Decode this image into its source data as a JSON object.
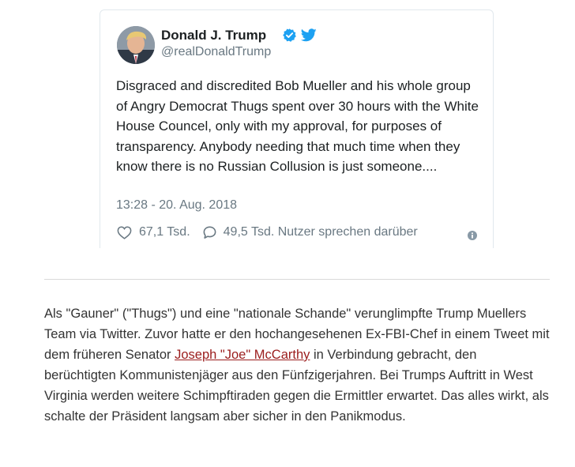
{
  "tweet": {
    "author_name": "Donald J. Trump",
    "author_handle": "@realDonaldTrump",
    "text": "Disgraced and discredited Bob Mueller and his whole group of Angry Democrat Thugs spent over 30 hours with the White House Councel, only with my approval, for purposes of transparency. Anybody needing that much time when they know there is no Russian Collusion is just someone....",
    "timestamp": "13:28 - 20. Aug. 2018",
    "likes": "67,1 Tsd.",
    "talking": "49,5 Tsd. Nutzer sprechen darüber",
    "icons": {
      "verified": "verified-badge-icon",
      "brand": "twitter-bird-icon",
      "like": "heart-icon",
      "reply": "speech-bubble-icon",
      "info": "info-icon"
    },
    "colors": {
      "verified": "#1da1f2",
      "twitter_blue": "#1da1f2",
      "meta_gray": "#697882"
    }
  },
  "article": {
    "text_before_link": "Als \"Gauner\" (\"Thugs\") und eine \"nationale Schande\" verunglimpfte Trump Muellers Team via Twitter. Zuvor hatte er den hochangesehenen Ex-FBI-Chef in einem Tweet mit dem früheren Senator ",
    "link_text": "Joseph \"Joe\" McCarthy",
    "text_after_link": " in Verbindung gebracht, den berüchtigten Kommunistenjäger aus den Fünfzigerjahren. Bei Trumps Auftritt in West Virginia werden weitere Schimpftiraden gegen die Ermittler erwartet. Das alles wirkt, als schalte der Präsident langsam aber sicher in den Panikmodus.",
    "link_color": "#9b1c1c"
  }
}
